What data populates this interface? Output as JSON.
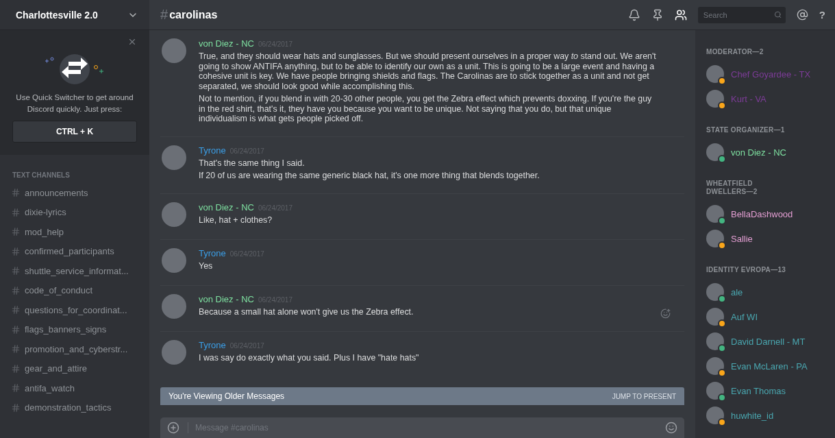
{
  "server": {
    "name": "Charlottesville 2.0"
  },
  "quick_switcher": {
    "text": "Use Quick Switcher to get around Discord quickly. Just press:",
    "shortcut": "CTRL + K"
  },
  "channel_section": {
    "title": "TEXT CHANNELS",
    "channels": [
      {
        "name": "announcements",
        "selected": false
      },
      {
        "name": "dixie-lyrics",
        "selected": false
      },
      {
        "name": "mod_help",
        "selected": false
      },
      {
        "name": "confirmed_participants",
        "selected": false
      },
      {
        "name": "shuttle_service_informat...",
        "selected": false
      },
      {
        "name": "code_of_conduct",
        "selected": false
      },
      {
        "name": "questions_for_coordinat...",
        "selected": false
      },
      {
        "name": "flags_banners_signs",
        "selected": false
      },
      {
        "name": "promotion_and_cyberstr...",
        "selected": false
      },
      {
        "name": "gear_and_attire",
        "selected": false
      },
      {
        "name": "antifa_watch",
        "selected": false
      },
      {
        "name": "demonstration_tactics",
        "selected": false
      }
    ]
  },
  "header": {
    "hash": "#",
    "channel": "carolinas",
    "search_placeholder": "Search",
    "help": "?"
  },
  "messages": [
    {
      "author": "von Diez - NC",
      "color": "#7ee0a0",
      "time": "06/24/2017",
      "lines": [
        "True, and they should wear hats and sunglasses. But we should present ourselves in a proper way *to* stand out. We aren't going to show ANTIFA anything, but to be able to identify our own as a unit. This is going to be a large event and having a cohesive unit is key. We have people bringing shields and flags. The Carolinas are to stick together as a unit and not get separated, we should look good while accomplishing this.",
        "Not to mention, if you blend in with 20-30 other people, you get the Zebra effect which prevents doxxing. If you're the guy in the red shirt, that's it, they have you because you want to be unique. Not saying that you do, but that unique individualism is what gets people picked off."
      ],
      "reaction_button": false
    },
    {
      "author": "Tyrone",
      "color": "#3b9fe8",
      "time": "06/24/2017",
      "lines": [
        "That's the same thing I said.",
        "If 20 of us are wearing the same generic black hat, it's one more thing that blends together."
      ],
      "reaction_button": false
    },
    {
      "author": "von Diez - NC",
      "color": "#7ee0a0",
      "time": "06/24/2017",
      "lines": [
        "Like, hat + clothes?"
      ],
      "reaction_button": false
    },
    {
      "author": "Tyrone",
      "color": "#3b9fe8",
      "time": "06/24/2017",
      "lines": [
        "Yes"
      ],
      "reaction_button": false
    },
    {
      "author": "von Diez - NC",
      "color": "#7ee0a0",
      "time": "06/24/2017",
      "lines": [
        "Because a small hat alone won't give us the Zebra effect."
      ],
      "reaction_button": true
    },
    {
      "author": "Tyrone",
      "color": "#3b9fe8",
      "time": "06/24/2017",
      "lines": [
        "I was say do exactly what you said. Plus I have \"hate hats\""
      ],
      "reaction_button": false
    }
  ],
  "older_banner": {
    "text": "You're Viewing Older Messages",
    "action": "JUMP TO PRESENT"
  },
  "composer": {
    "placeholder": "Message #carolinas"
  },
  "member_groups": [
    {
      "title": "MODERATOR—2",
      "members": [
        {
          "name": "Chef Goyardee - TX",
          "color": "#7d3c98",
          "online": false
        },
        {
          "name": "Kurt - VA",
          "color": "#7d3c98",
          "online": false
        }
      ]
    },
    {
      "title": "STATE ORGANIZER—1",
      "members": [
        {
          "name": "von Diez - NC",
          "color": "#7ee0a0",
          "online": true
        }
      ]
    },
    {
      "title": "WHEATFIELD DWELLERS—2",
      "members": [
        {
          "name": "BellaDashwood",
          "color": "#e59fd4",
          "online": true
        },
        {
          "name": "Sallie",
          "color": "#e59fd4",
          "online": false
        }
      ]
    },
    {
      "title": "IDENTITY EVROPA—13",
      "members": [
        {
          "name": "ale",
          "color": "#4aa7b0",
          "online": true
        },
        {
          "name": "Auf WI",
          "color": "#4aa7b0",
          "online": false
        },
        {
          "name": "David Darnell - MT",
          "color": "#4aa7b0",
          "online": true
        },
        {
          "name": "Evan McLaren - PA",
          "color": "#4aa7b0",
          "online": false
        },
        {
          "name": "Evan Thomas",
          "color": "#4aa7b0",
          "online": true
        },
        {
          "name": "huwhite_id",
          "color": "#4aa7b0",
          "online": false
        }
      ]
    }
  ]
}
